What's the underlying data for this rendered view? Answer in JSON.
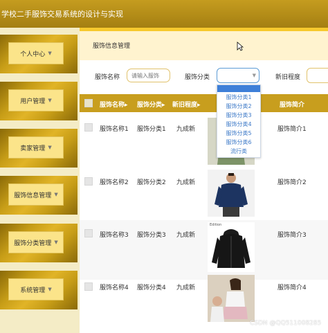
{
  "app": {
    "title": "学校二手服饰交易系统的设计与实现"
  },
  "sidebar": {
    "items": [
      {
        "label": "个人中心"
      },
      {
        "label": "用户管理"
      },
      {
        "label": "卖家管理"
      },
      {
        "label": "服饰信息管理"
      },
      {
        "label": "服饰分类管理"
      },
      {
        "label": "系统管理"
      }
    ]
  },
  "breadcrumb": "服饰信息管理",
  "filters": {
    "name_label": "服饰名称",
    "name_placeholder": "请输入服饰",
    "category_label": "服饰分类",
    "condition_label": "新旧程度"
  },
  "dropdown": {
    "options": [
      "服饰分类1",
      "服饰分类2",
      "服饰分类3",
      "服饰分类4",
      "服饰分类5",
      "服饰分类6",
      "流行类"
    ]
  },
  "table": {
    "headers": [
      "服饰名称",
      "服饰分类",
      "新旧程度",
      "服饰简介"
    ],
    "rows": [
      {
        "name": "服饰名称1",
        "category": "服饰分类1",
        "condition": "九成新",
        "intro": "服饰简介1"
      },
      {
        "name": "服饰名称2",
        "category": "服饰分类2",
        "condition": "九成新",
        "intro": "服饰简介2"
      },
      {
        "name": "服饰名称3",
        "category": "服饰分类3",
        "condition": "九成新",
        "intro": "服饰简介3"
      },
      {
        "name": "服饰名称4",
        "category": "服饰分类4",
        "condition": "九成新",
        "intro": "服饰简介4"
      }
    ]
  },
  "photo_caption": "Edition",
  "watermark": "CSDN @QQ511008285",
  "colors": {
    "header": "#b08a1c",
    "table_header": "#c89e1e",
    "accent": "#f6c92e",
    "dropdown_text": "#3b78c7"
  }
}
